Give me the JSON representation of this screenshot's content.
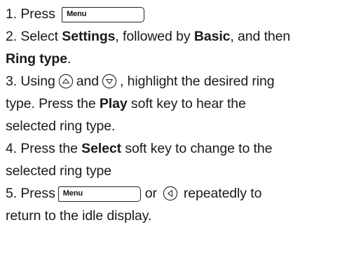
{
  "step1": {
    "prefix": "1. Press",
    "menu_key_label": "Menu"
  },
  "step2": {
    "part1": "2. Select ",
    "settings": "Settings",
    "part2": ", followed by ",
    "basic": "Basic",
    "part3": ", and then",
    "ring_type": "Ring type",
    "end": "."
  },
  "step3": {
    "part1": "3. Using",
    "and": "and",
    "part2": ", highlight the desired ring",
    "line2a": "type. Press the ",
    "play": "Play",
    "line2b": " soft key to hear the",
    "line3": "selected ring type."
  },
  "step4": {
    "part1": "4. Press the ",
    "select": "Select",
    "part2": " soft key to change to the",
    "line2": "selected ring type"
  },
  "step5": {
    "prefix": "5. Press",
    "menu_key_label": "Menu",
    "or": "or",
    "suffix": "repeatedly to",
    "line2": "return to the idle display."
  },
  "icons": {
    "up": "up-arrow-key-icon",
    "down": "down-arrow-key-icon",
    "left": "left-arrow-key-icon"
  }
}
